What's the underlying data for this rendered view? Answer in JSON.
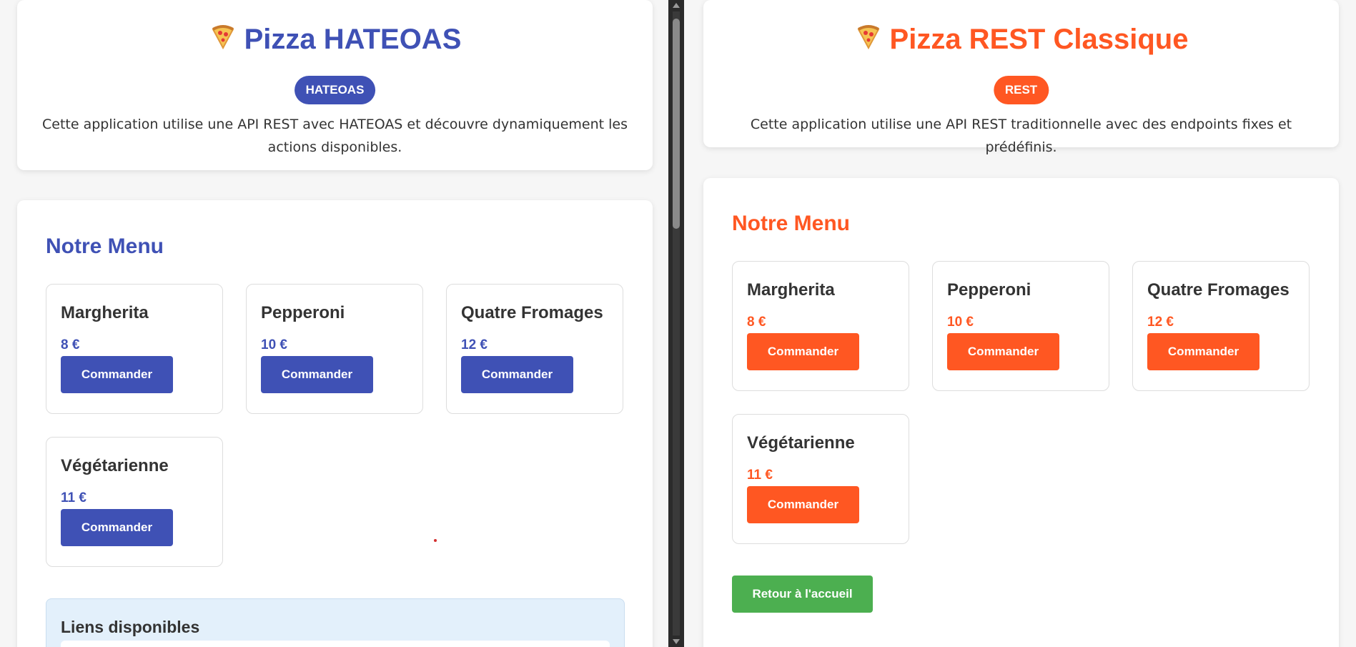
{
  "hateoas_app": {
    "title": "Pizza HATEOAS",
    "title_icon": "pizza-icon",
    "badge": "HATEOAS",
    "description": "Cette application utilise une API REST avec HATEOAS et découvre dynamiquement les actions disponibles.",
    "menu_title": "Notre Menu",
    "pizzas": [
      {
        "name": "Margherita",
        "price": "8 €",
        "button": "Commander"
      },
      {
        "name": "Pepperoni",
        "price": "10 €",
        "button": "Commander"
      },
      {
        "name": "Quatre Fromages",
        "price": "12 €",
        "button": "Commander"
      },
      {
        "name": "Végétarienne",
        "price": "11 €",
        "button": "Commander"
      }
    ],
    "links_title": "Liens disponibles",
    "accent_color": "#3f51b5"
  },
  "rest_app": {
    "title": "Pizza REST Classique",
    "title_icon": "pizza-icon",
    "badge": "REST",
    "description": "Cette application utilise une API REST traditionnelle avec des endpoints fixes et prédéfinis.",
    "menu_title": "Notre Menu",
    "pizzas": [
      {
        "name": "Margherita",
        "price": "8 €",
        "button": "Commander"
      },
      {
        "name": "Pepperoni",
        "price": "10 €",
        "button": "Commander"
      },
      {
        "name": "Quatre Fromages",
        "price": "12 €",
        "button": "Commander"
      },
      {
        "name": "Végétarienne",
        "price": "11 €",
        "button": "Commander"
      }
    ],
    "home_button": "Retour à l'accueil",
    "accent_color": "#ff5722",
    "home_button_color": "#4caf50"
  }
}
